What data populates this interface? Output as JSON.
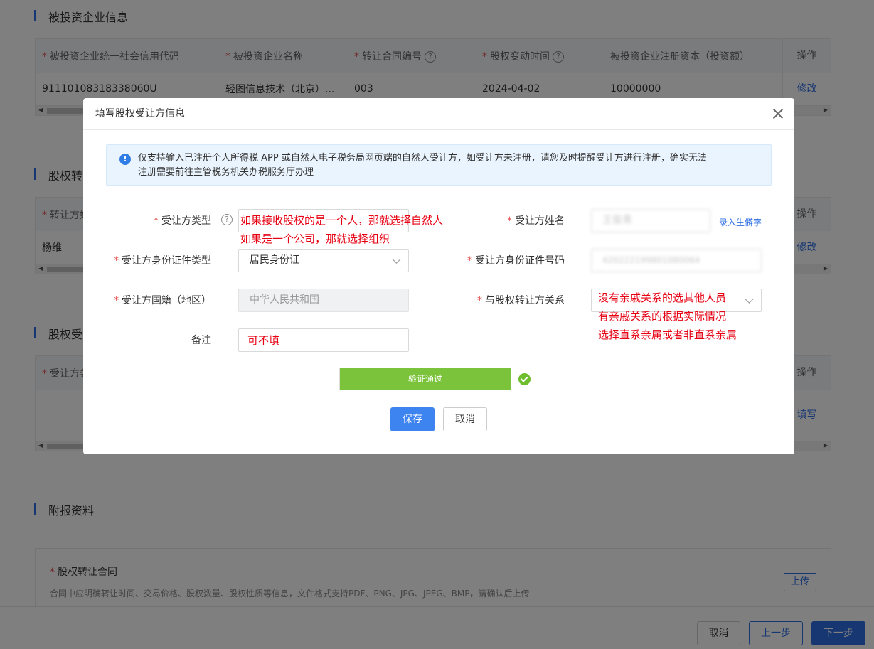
{
  "background": {
    "section1": {
      "title": "被投资企业信息",
      "columns": [
        "被投资企业统一社会信用代码",
        "被投资企业名称",
        "转让合同编号",
        "股权变动时间",
        "被投资企业注册资本（投资额）"
      ],
      "row": [
        "91110108318338060U",
        "轻图信息技术（北京）...",
        "003",
        "2024-04-02",
        "10000000"
      ],
      "op_header": "操作",
      "op_link": "修改"
    },
    "section2": {
      "title": "股权转",
      "col1": "转让方姓",
      "row1": "杨维",
      "op_header": "操作",
      "op_link": "修改"
    },
    "section3": {
      "title": "股权受",
      "col1": "受让方务",
      "op_header": "操作",
      "op_link": "填写"
    },
    "section4": {
      "title": "附报资料",
      "item_title": "股权转让合同",
      "item_desc": "合同中应明确转让时间、交易价格、股权数量、股权性质等信息，文件格式支持PDF、PNG、JPG、JPEG、BMP，请确认后上传",
      "upload": "上传"
    },
    "footer": {
      "cancel": "取消",
      "prev": "上一步",
      "next": "下一步"
    }
  },
  "modal": {
    "title": "填写股权受让方信息",
    "notice_line1": "仅支持输入已注册个人所得税 APP 或自然人电子税务局网页端的自然人受让方，如受让方未注册，请您及时提醒受让方进行注册，确实无法",
    "notice_line2": "注册需要前往主管税务机关办税服务厅办理",
    "fields": {
      "type_label": "受让方类型",
      "name_label": "受让方姓名",
      "name_value": "王俊青",
      "rare_char_link": "录入生僻字",
      "id_type_label": "受让方身份证件类型",
      "id_type_value": "居民身份证",
      "id_no_label": "受让方身份证件号码",
      "id_no_value": "420222199801080064",
      "nation_label": "受让方国籍（地区）",
      "nation_value": "中华人民共和国",
      "relation_label": "与股权转让方关系",
      "remark_label": "备注"
    },
    "annotations": {
      "type_note_1": "如果接收股权的是一个人，那就选择自然人",
      "type_note_2": "如果是一个公司，那就选择组织",
      "relation_note_1": "没有亲戚关系的选其他人员",
      "relation_note_2": "有亲戚关系的根据实际情况",
      "relation_note_3": "选择直系亲属或者非直系亲属",
      "remark_note": "可不填"
    },
    "verify_text": "验证通过",
    "save": "保存",
    "cancel": "取消"
  }
}
